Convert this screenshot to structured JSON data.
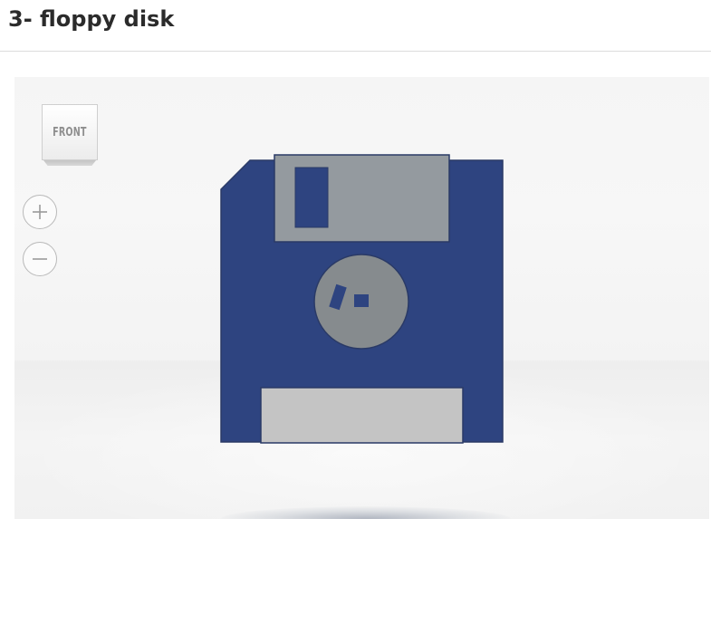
{
  "page": {
    "title": "3- floppy disk"
  },
  "viewer": {
    "view_cube_label": "FRONT",
    "zoom_in_icon": "plus-icon",
    "zoom_out_icon": "minus-icon"
  },
  "model": {
    "name": "floppy disk",
    "colors": {
      "body": "#2e4480",
      "shutter": "#949a9f",
      "hub": "#868b8e",
      "label": "#c4c4c4",
      "outline": "#2a3a66"
    }
  }
}
